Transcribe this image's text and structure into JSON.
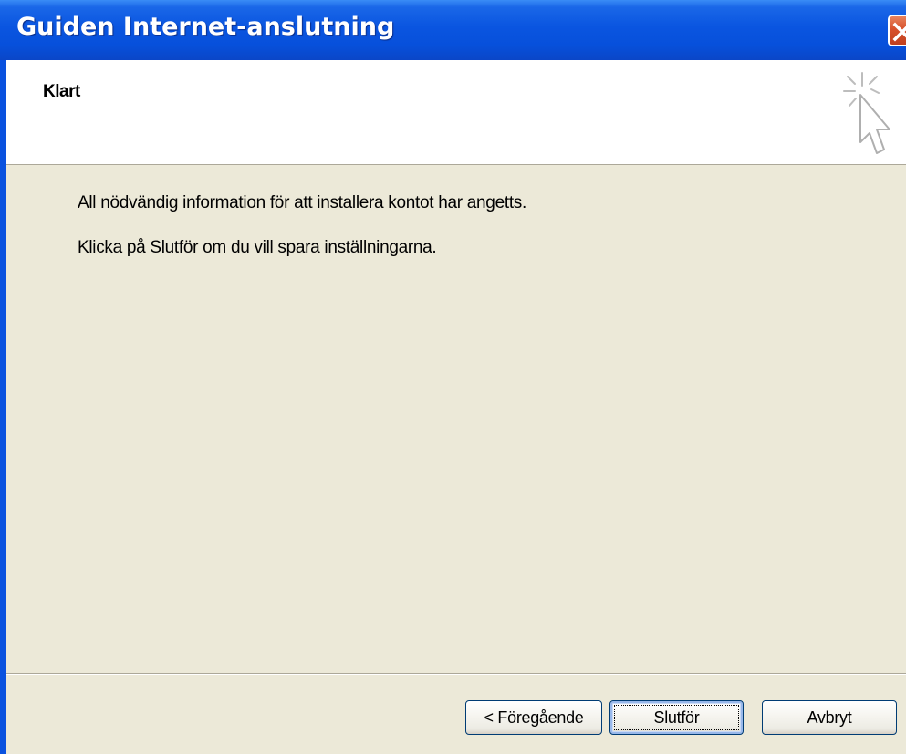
{
  "window": {
    "title": "Guiden Internet-anslutning"
  },
  "header": {
    "title": "Klart",
    "icon": "wizard-cursor-icon"
  },
  "body": {
    "line1": "All nödvändig information för att installera kontot har angetts.",
    "line2": "Klicka på Slutför om du vill spara inställningarna."
  },
  "buttons": {
    "back": "< Föregående",
    "finish": "Slutför",
    "cancel": "Avbryt"
  },
  "colors": {
    "titlebar": "#0A55E0",
    "dialog_bg": "#ECE9D8",
    "close": "#D7502B"
  }
}
